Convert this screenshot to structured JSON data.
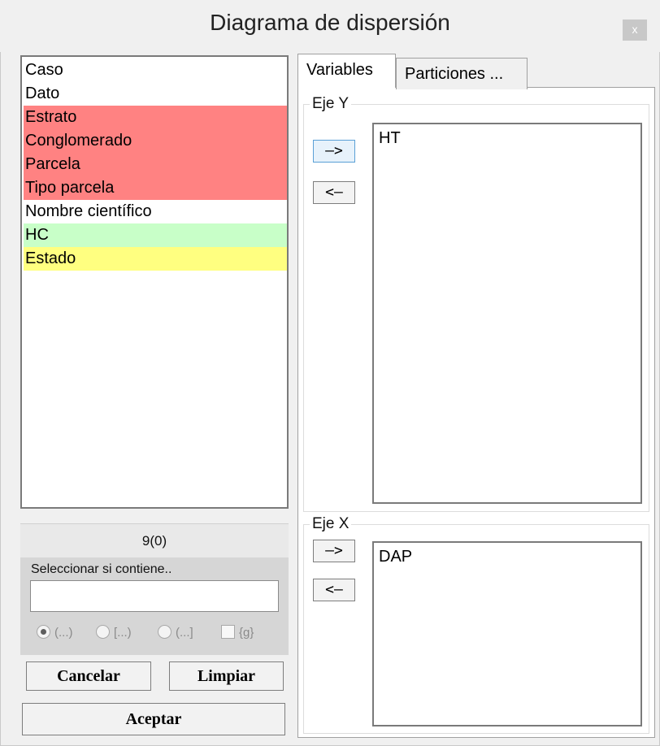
{
  "window": {
    "title": "Diagrama de dispersión",
    "close_label": "x"
  },
  "variables_list": {
    "items": [
      {
        "label": "Caso",
        "color": "#ffffff"
      },
      {
        "label": "Dato",
        "color": "#ffffff"
      },
      {
        "label": "Estrato",
        "color": "#ff8282"
      },
      {
        "label": "Conglomerado",
        "color": "#ff8282"
      },
      {
        "label": "Parcela",
        "color": "#ff8282"
      },
      {
        "label": "Tipo parcela",
        "color": "#ff8282"
      },
      {
        "label": "Nombre científico",
        "color": "#ffffff"
      },
      {
        "label": "HC",
        "color": "#c8ffc8"
      },
      {
        "label": "Estado",
        "color": "#ffff80"
      }
    ]
  },
  "count_label": "9(0)",
  "filter": {
    "label": "Seleccionar si contiene..",
    "value": "",
    "options": [
      "(...)",
      "[...)",
      "(...]",
      "{g}"
    ],
    "selected_option": "(...)"
  },
  "buttons": {
    "cancel": "Cancelar",
    "clear": "Limpiar",
    "accept": "Aceptar"
  },
  "tabs": [
    {
      "label": "Variables",
      "active": true
    },
    {
      "label": "Particiones ...",
      "active": false
    }
  ],
  "eje_y": {
    "legend": "Eje Y",
    "add_label": "–>",
    "remove_label": "<–",
    "assigned": "HT"
  },
  "eje_x": {
    "legend": "Eje X",
    "add_label": "–>",
    "remove_label": "<–",
    "assigned": "DAP"
  }
}
